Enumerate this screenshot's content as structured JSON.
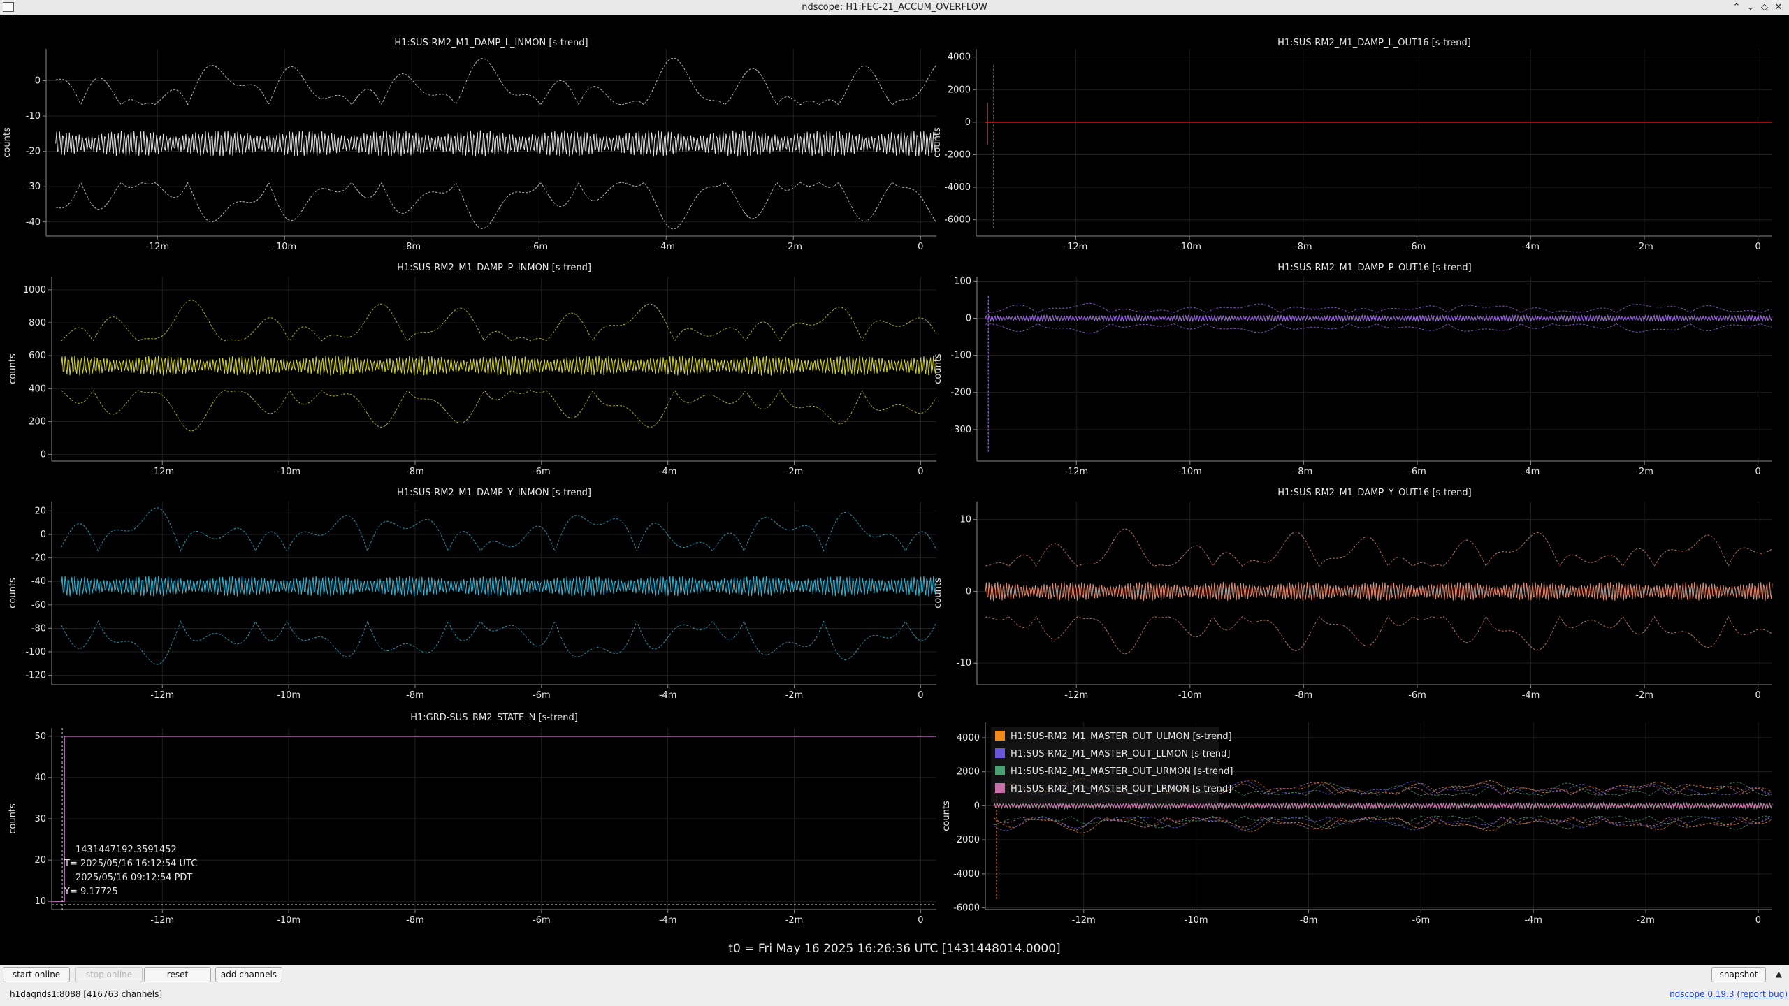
{
  "window": {
    "title": "ndscope: H1:FEC-21_ACCUM_OVERFLOW"
  },
  "t0_label": "t0 = Fri May 16 2025 16:26:36 UTC [1431448014.0000]",
  "toolbar": {
    "start_online": "start online",
    "stop_online": "stop online",
    "reset": "reset",
    "add_channels": "add channels",
    "snapshot": "snapshot"
  },
  "status": {
    "server": "h1daqnds1:8088  [416763 channels]",
    "app_name": "ndscope",
    "version": "0.19.3",
    "report_bug": "(report bug)"
  },
  "cursor": {
    "gps": "1431447192.3591452",
    "t_utc": "T= 2025/05/16 16:12:54 UTC",
    "t_pdt": "2025/05/16 09:12:54 PDT",
    "y": "Y= 9.17725"
  },
  "chart_data": [
    {
      "type": "line",
      "title": "H1:SUS-RM2_M1_DAMP_L_INMON [s-trend]",
      "ylabel": "counts",
      "xlabel": "",
      "ylim": [
        -44,
        9
      ],
      "yticks": [
        0,
        -10,
        -20,
        -30,
        -40
      ],
      "xticks": [
        "-12m",
        "-10m",
        "-8m",
        "-6m",
        "-4m",
        "-2m",
        "0"
      ],
      "xlim_min": [
        -13.75,
        0.25
      ],
      "grid": true,
      "series": [
        {
          "color": "#e0e0e0",
          "kind": "mean",
          "mean": -17.8,
          "amp": 3.4,
          "env_amp": 10.5,
          "env_base": 11
        }
      ]
    },
    {
      "type": "line",
      "title": "H1:SUS-RM2_M1_DAMP_L_OUT16 [s-trend]",
      "ylabel": "counts",
      "xlabel": "",
      "ylim": [
        -7000,
        4500
      ],
      "yticks": [
        4000,
        2000,
        0,
        -2000,
        -4000,
        -6000
      ],
      "xticks": [
        "-12m",
        "-10m",
        "-8m",
        "-6m",
        "-4m",
        "-2m",
        "0"
      ],
      "xlim_min": [
        -13.75,
        0.25
      ],
      "grid": true,
      "series": [
        {
          "color": "#c83030",
          "kind": "spike",
          "level": 0,
          "spike_min": -6500,
          "spike_max": 3500
        }
      ]
    },
    {
      "type": "line",
      "title": "H1:SUS-RM2_M1_DAMP_P_INMON [s-trend]",
      "ylabel": "counts",
      "xlabel": "",
      "ylim": [
        -40,
        1080
      ],
      "yticks": [
        1000,
        800,
        600,
        400,
        200,
        0
      ],
      "xticks": [
        "-12m",
        "-10m",
        "-8m",
        "-6m",
        "-4m",
        "-2m",
        "0"
      ],
      "xlim_min": [
        -13.75,
        0.25
      ],
      "grid": true,
      "series": [
        {
          "color": "#d6d61f",
          "kind": "mean",
          "mean": 540,
          "amp": 55,
          "env_amp": 190,
          "env_base": 150
        }
      ]
    },
    {
      "type": "line",
      "title": "H1:SUS-RM2_M1_DAMP_P_OUT16 [s-trend]",
      "ylabel": "counts",
      "xlabel": "",
      "ylim": [
        -385,
        112
      ],
      "yticks": [
        100,
        0,
        -100,
        -200,
        -300
      ],
      "xticks": [
        "-12m",
        "-10m",
        "-8m",
        "-6m",
        "-4m",
        "-2m",
        "0"
      ],
      "xlim_min": [
        -13.75,
        0.25
      ],
      "grid": true,
      "series": [
        {
          "color": "#9b6be0",
          "kind": "mean",
          "mean": 0,
          "amp": 8,
          "env_amp": 22,
          "env_base": 15,
          "spike_min": -360,
          "spike_max": 60
        }
      ]
    },
    {
      "type": "line",
      "title": "H1:SUS-RM2_M1_DAMP_Y_INMON [s-trend]",
      "ylabel": "counts",
      "xlabel": "",
      "ylim": [
        -128,
        28
      ],
      "yticks": [
        20,
        0,
        -20,
        -40,
        -60,
        -80,
        -100,
        -120
      ],
      "xticks": [
        "-12m",
        "-10m",
        "-8m",
        "-6m",
        "-4m",
        "-2m",
        "0"
      ],
      "xlim_min": [
        -13.75,
        0.25
      ],
      "grid": true,
      "series": [
        {
          "color": "#2bb8d8",
          "kind": "mean",
          "mean": -44,
          "amp": 8,
          "env_amp": 32,
          "env_base": 30
        }
      ]
    },
    {
      "type": "line",
      "title": "H1:SUS-RM2_M1_DAMP_Y_OUT16 [s-trend]",
      "ylabel": "counts",
      "xlabel": "",
      "ylim": [
        -13,
        12.5
      ],
      "yticks": [
        10,
        0,
        -10
      ],
      "xticks": [
        "-12m",
        "-10m",
        "-8m",
        "-6m",
        "-4m",
        "-2m",
        "0"
      ],
      "xlim_min": [
        -13.75,
        0.25
      ],
      "grid": true,
      "series": [
        {
          "color": "#e28a6c",
          "kind": "mean",
          "mean": 0,
          "amp": 1.2,
          "env_amp": 4,
          "env_base": 3.5
        }
      ]
    },
    {
      "type": "line",
      "title": "H1:GRD-SUS_RM2_STATE_N [s-trend]",
      "ylabel": "counts",
      "xlabel": "",
      "ylim": [
        8,
        52
      ],
      "yticks": [
        50,
        40,
        30,
        20,
        10
      ],
      "xticks": [
        "-12m",
        "-10m",
        "-8m",
        "-6m",
        "-4m",
        "-2m",
        "0"
      ],
      "xlim_min": [
        -13.75,
        0.25
      ],
      "grid": true,
      "series": [
        {
          "color": "#d070d0",
          "kind": "step",
          "start": 10,
          "end": 50,
          "step_at_min": -13.55
        }
      ]
    },
    {
      "type": "line",
      "title": "",
      "ylabel": "counts",
      "xlabel": "",
      "ylim": [
        -6100,
        4900
      ],
      "yticks": [
        4000,
        2000,
        0,
        -2000,
        -4000,
        -6000
      ],
      "xticks": [
        "-12m",
        "-10m",
        "-8m",
        "-6m",
        "-4m",
        "-2m",
        "0"
      ],
      "xlim_min": [
        -13.75,
        0.25
      ],
      "grid": true,
      "legend_position": "top-left",
      "series": [
        {
          "name": "H1:SUS-RM2_M1_MASTER_OUT_ULMON [s-trend]",
          "color": "#f08a1c",
          "kind": "mean",
          "mean": 0,
          "amp": 150,
          "env_amp": 700,
          "env_base": 700,
          "spike_min": -5500,
          "spike_max": 800
        },
        {
          "name": "H1:SUS-RM2_M1_MASTER_OUT_LLMON [s-trend]",
          "color": "#6a56d8",
          "kind": "mean",
          "mean": 0,
          "amp": 150,
          "env_amp": 650,
          "env_base": 650
        },
        {
          "name": "H1:SUS-RM2_M1_MASTER_OUT_URMON [s-trend]",
          "color": "#4aa070",
          "kind": "mean",
          "mean": 0,
          "amp": 150,
          "env_amp": 600,
          "env_base": 600
        },
        {
          "name": "H1:SUS-RM2_M1_MASTER_OUT_LRMON [s-trend]",
          "color": "#c870a8",
          "kind": "mean",
          "mean": 0,
          "amp": 150,
          "env_amp": 650,
          "env_base": 650
        }
      ]
    }
  ]
}
